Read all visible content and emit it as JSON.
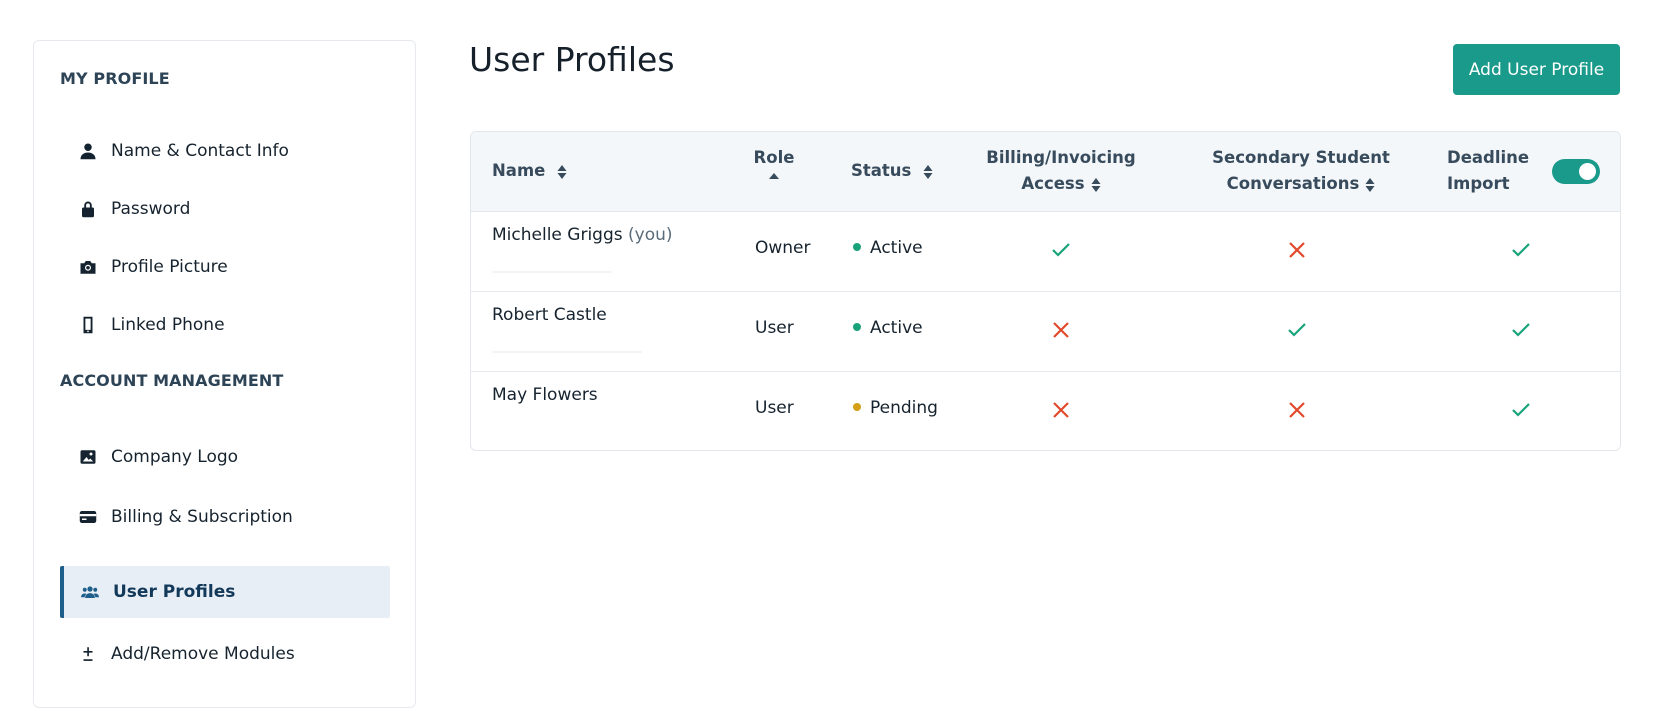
{
  "sidebar": {
    "my_profile_title": "MY PROFILE",
    "account_title": "ACCOUNT MANAGEMENT",
    "items": [
      {
        "label": "Name & Contact Info",
        "icon": "person-icon"
      },
      {
        "label": "Password",
        "icon": "lock-icon"
      },
      {
        "label": "Profile Picture",
        "icon": "camera-icon"
      },
      {
        "label": "Linked Phone",
        "icon": "phone-icon"
      },
      {
        "label": "Company Logo",
        "icon": "image-icon"
      },
      {
        "label": "Billing & Subscription",
        "icon": "credit-card-icon"
      },
      {
        "label": "User Profiles",
        "icon": "users-icon",
        "active": true
      },
      {
        "label": "Add/Remove Modules",
        "icon": "plus-minus-icon"
      }
    ]
  },
  "header": {
    "title": "User Profiles",
    "add_button_label": "Add User Profile"
  },
  "table": {
    "columns": {
      "name": "Name",
      "role": "Role",
      "status": "Status",
      "billing_line1": "Billing/Invoicing",
      "billing_line2": "Access",
      "secondary_line1": "Secondary Student",
      "secondary_line2": "Conversations",
      "deadline_line1": "Deadline",
      "deadline_line2": "Import"
    },
    "deadline_toggle_on": true,
    "rows": [
      {
        "name": "Michelle Griggs",
        "suffix": "(you)",
        "role": "Owner",
        "status": "Active",
        "status_color": "#1aa37a",
        "billing": true,
        "secondary": false,
        "deadline": true
      },
      {
        "name": "Robert Castle",
        "suffix": "",
        "role": "User",
        "status": "Active",
        "status_color": "#1aa37a",
        "billing": false,
        "secondary": true,
        "deadline": true
      },
      {
        "name": "May Flowers",
        "suffix": "",
        "role": "User",
        "status": "Pending",
        "status_color": "#d4a017",
        "billing": false,
        "secondary": false,
        "deadline": true
      }
    ]
  },
  "colors": {
    "accent": "#1a9a8a",
    "check": "#1aa37a",
    "cross": "#e0492c",
    "active_nav": "#1f5f8b"
  }
}
